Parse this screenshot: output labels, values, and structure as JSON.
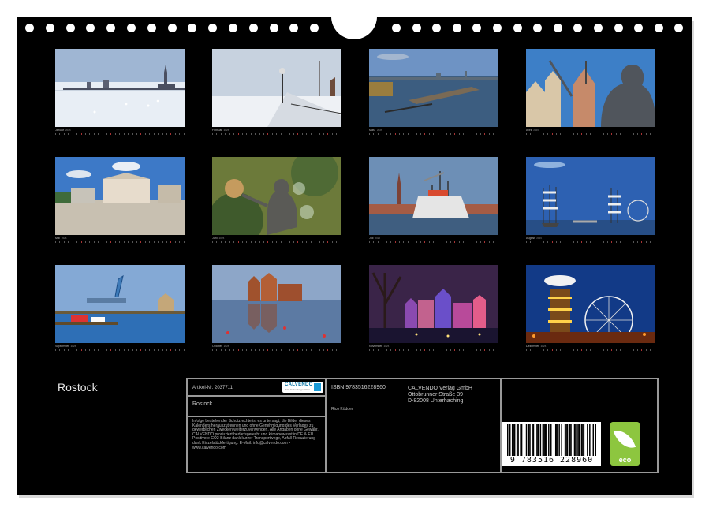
{
  "calendar_title": "Rostock",
  "months": [
    {
      "name": "Januar",
      "year": "2026",
      "scene": "winter-skyline"
    },
    {
      "name": "Februar",
      "year": "2026",
      "scene": "snow-promenade"
    },
    {
      "name": "März",
      "year": "2026",
      "scene": "flooded-harbour"
    },
    {
      "name": "April",
      "year": "2026",
      "scene": "statue-gables"
    },
    {
      "name": "Mai",
      "year": "2026",
      "scene": "town-hall-square"
    },
    {
      "name": "Juni",
      "year": "2026",
      "scene": "fountain-sculpture"
    },
    {
      "name": "Juli",
      "year": "2026",
      "scene": "museum-ship"
    },
    {
      "name": "August",
      "year": "2026",
      "scene": "tall-ships"
    },
    {
      "name": "September",
      "year": "2026",
      "scene": "shipyard-harbour"
    },
    {
      "name": "Oktober",
      "year": "2026",
      "scene": "granary-reflection"
    },
    {
      "name": "November",
      "year": "2026",
      "scene": "night-street"
    },
    {
      "name": "Dezember",
      "year": "2026",
      "scene": "christmas-market"
    }
  ],
  "info": {
    "article": "Artikel-Nr. 2037711",
    "book_title": "Rostock",
    "isbn": "ISBN 9783516228960",
    "publisher_lines": [
      "CALVENDO Verlag GmbH",
      "Ottobrunner Straße 39",
      "D-82008 Unterhaching"
    ],
    "author": "Rico Ködder",
    "legal_text": "Infolge bestehender Schutzrechte ist es untersagt, die Bilder dieses Kalenders herauszutrennen und ohne Genehmigung des Verlages zu gewerblichen Zwecken weiterzuverwenden. Alle Angaben ohne Gewähr. CALVENDO produziert bedarfsgerecht und klimabewusst in DE & EU. Positivere CO2-Bilanz dank kurzer Transportwege, Abfall-Reduzierung dank Einzelstückfertigung. E-Mail: info@calvendo.com • www.calvendo.com",
    "calvendo_logo": "CALVENDO",
    "calvendo_tag": "Jetzt Kalender gestalten",
    "barcode_number": "9 783516 228960",
    "eco_label": "eco"
  },
  "colors": {
    "sheet": "#000000",
    "eco": "#8dc63f",
    "calvendo": "#1b9bd7"
  }
}
